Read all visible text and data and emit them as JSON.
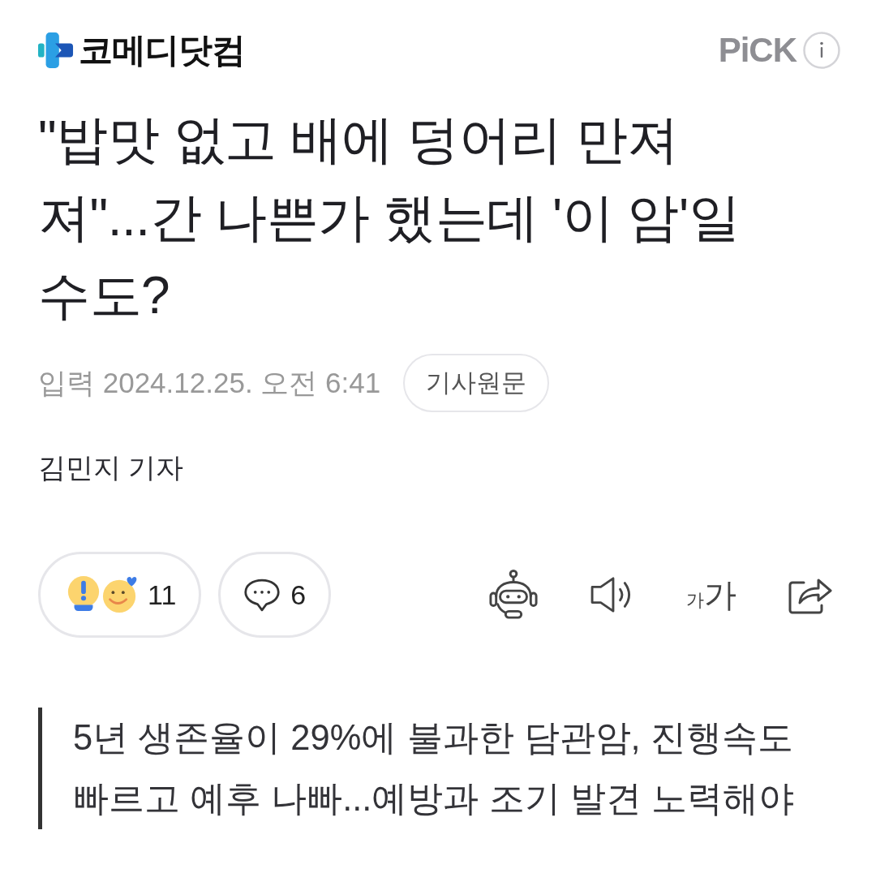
{
  "header": {
    "logo_text": "코메디닷컴",
    "pick_label": "PiCK"
  },
  "article": {
    "title": "\"밥맛 없고 배에 덩어리 만져져\"...간 나쁜가 했는데 '이 암'일 수도?",
    "published": "입력 2024.12.25. 오전 6:41",
    "original_link": "기사원문",
    "reporter": "김민지 기자"
  },
  "actions": {
    "reactions": {
      "count": "11"
    },
    "comments": {
      "count": "6"
    },
    "font_size": {
      "small": "가",
      "large": "가"
    }
  },
  "summary": "5년 생존율이 29%에 불과한 담관암, 진행속도 빠르고 예후 나빠...예방과 조기 발견 노력해야"
}
